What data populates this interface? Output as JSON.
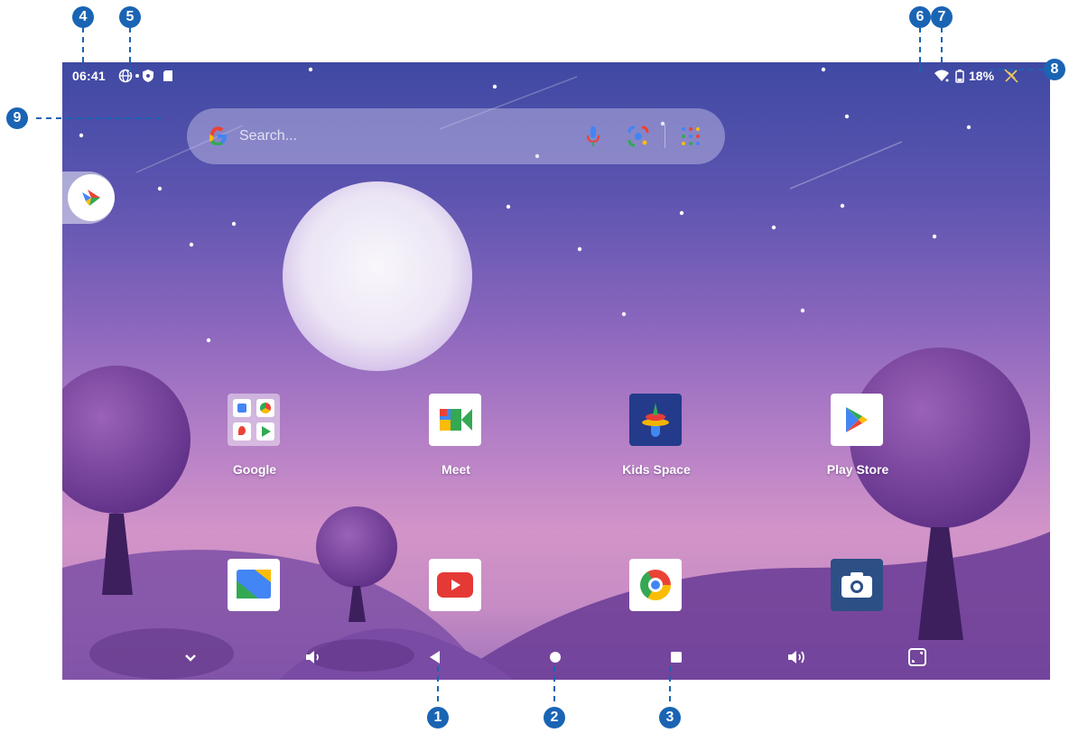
{
  "status_bar": {
    "time": "06:41",
    "icons": [
      "vpn-globe-icon",
      "notification-dot-icon",
      "shield-icon",
      "sd-card-icon",
      "wifi-icon",
      "battery-icon",
      "no-charging-icon"
    ],
    "battery_percent": "18%"
  },
  "search": {
    "placeholder": "Search...",
    "icons": [
      "google-g-icon",
      "microphone-icon",
      "lens-icon",
      "app-grid-icon"
    ]
  },
  "side_app": {
    "icon": "google-pay-icon"
  },
  "apps": {
    "row1": [
      {
        "label": "Google",
        "icon": "google-folder-icon"
      },
      {
        "label": "Meet",
        "icon": "meet-icon"
      },
      {
        "label": "Kids Space",
        "icon": "kids-space-icon"
      },
      {
        "label": "Play Store",
        "icon": "play-store-icon"
      }
    ],
    "row2": [
      {
        "label": "",
        "icon": "files-icon"
      },
      {
        "label": "",
        "icon": "youtube-icon"
      },
      {
        "label": "",
        "icon": "chrome-icon"
      },
      {
        "label": "",
        "icon": "camera-icon"
      }
    ]
  },
  "nav_bar": {
    "buttons": [
      "collapse-chevron-icon",
      "volume-down-icon",
      "back-icon",
      "home-icon",
      "recents-icon",
      "volume-up-icon",
      "screenshot-icon"
    ]
  },
  "callouts": [
    "1",
    "2",
    "3",
    "4",
    "5",
    "6",
    "7",
    "8",
    "9"
  ],
  "colors": {
    "callout": "#1a64b4",
    "accent_google_blue": "#4285f4",
    "youtube_red": "#e53935"
  }
}
